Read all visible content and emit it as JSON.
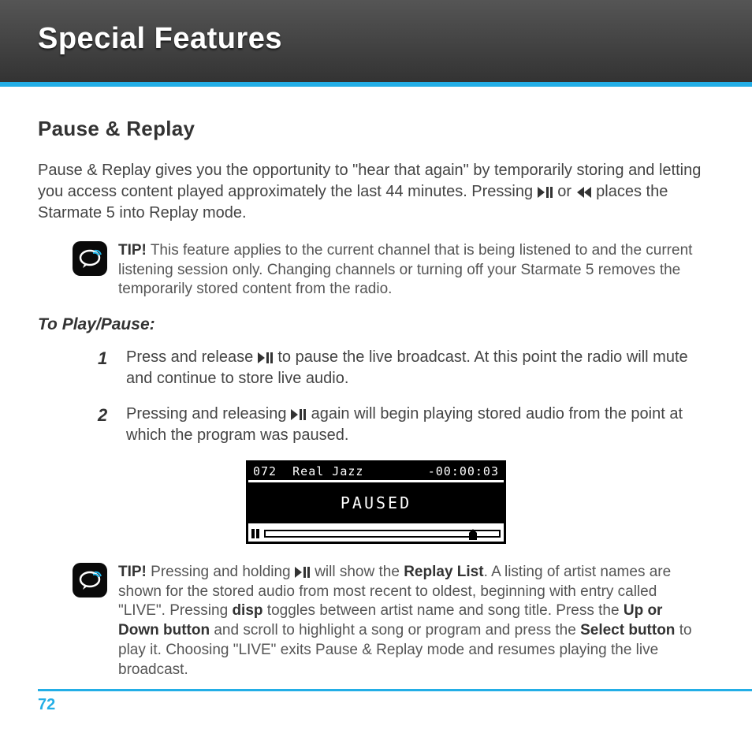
{
  "header": {
    "title": "Special Features"
  },
  "section": {
    "heading": "Pause & Replay",
    "intro_a": "Pause & Replay gives you the opportunity to \"hear that again\" by temporarily storing and letting you access content played approximately the last 44 minutes. Pressing",
    "intro_b": "or",
    "intro_c": "places the Starmate 5 into Replay mode."
  },
  "tip1": {
    "label": "TIP!",
    "text": "This feature applies to the current channel that is being listened to and the current listening session only. Changing channels or turning off your Starmate 5 removes the temporarily stored content from the radio."
  },
  "subhead": "To Play/Pause:",
  "steps": {
    "s1a": "Press and release ",
    "s1b": " to pause the live broadcast. At this point the radio will mute and continue to store live audio.",
    "s2a": "Pressing and releasing",
    "s2b": " again will begin playing stored audio from the point at which the program was paused."
  },
  "lcd": {
    "ch": "072",
    "name": "Real Jazz",
    "time": "-00:00:03",
    "status": "PAUSED"
  },
  "tip2": {
    "label": "TIP!",
    "pre": "Pressing and holding",
    "mid1": " will show the ",
    "replay_list": "Replay List",
    "mid2": ". A listing of artist names are shown for the stored audio from most recent to oldest, beginning with entry called \"LIVE\". Pressing ",
    "disp": "disp",
    "mid3": " toggles between artist name and song title. Press the ",
    "updown": "Up or Down button",
    "mid4": " and scroll to highlight a song or program and press the ",
    "select": "Select button",
    "mid5": " to play it. Choosing \"LIVE\" exits Pause & Replay mode and resumes playing the live broadcast."
  },
  "page": "72"
}
